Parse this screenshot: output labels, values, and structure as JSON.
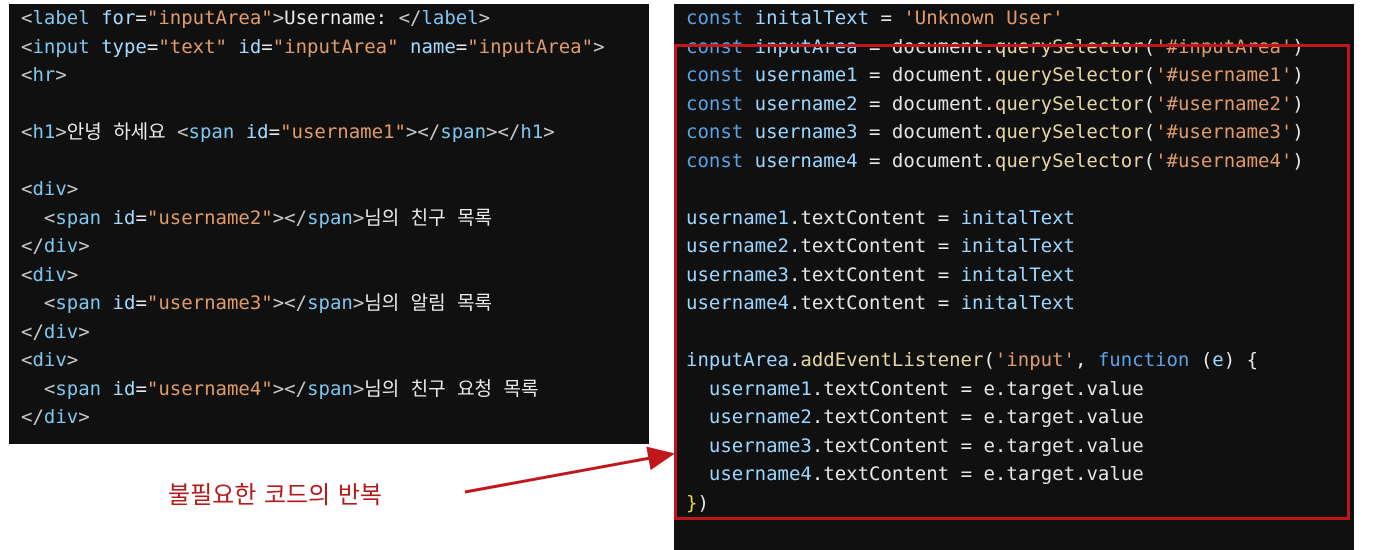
{
  "html_panel": {
    "lines": [
      [
        [
          "c-tag",
          "<"
        ],
        [
          "c-tagname",
          "label"
        ],
        [
          "c-attr",
          " for"
        ],
        [
          "c-punc",
          "="
        ],
        [
          "c-str",
          "\"inputArea\""
        ],
        [
          "c-tag",
          ">"
        ],
        [
          "c-text",
          "Username: "
        ],
        [
          "c-tag",
          "</"
        ],
        [
          "c-tagname",
          "label"
        ],
        [
          "c-tag",
          ">"
        ]
      ],
      [
        [
          "c-tag",
          "<"
        ],
        [
          "c-tagname",
          "input"
        ],
        [
          "c-attr",
          " type"
        ],
        [
          "c-punc",
          "="
        ],
        [
          "c-str",
          "\"text\""
        ],
        [
          "c-attr",
          " id"
        ],
        [
          "c-punc",
          "="
        ],
        [
          "c-str",
          "\"inputArea\""
        ],
        [
          "c-attr",
          " name"
        ],
        [
          "c-punc",
          "="
        ],
        [
          "c-str",
          "\"inputArea\""
        ],
        [
          "c-tag",
          ">"
        ]
      ],
      [
        [
          "c-tag",
          "<"
        ],
        [
          "c-tagname",
          "hr"
        ],
        [
          "c-tag",
          ">"
        ]
      ],
      [],
      [
        [
          "c-tag",
          "<"
        ],
        [
          "c-tagname",
          "h1"
        ],
        [
          "c-tag",
          ">"
        ],
        [
          "c-text",
          "안녕 하세요 "
        ],
        [
          "c-tag",
          "<"
        ],
        [
          "c-tagname",
          "span"
        ],
        [
          "c-attr",
          " id"
        ],
        [
          "c-punc",
          "="
        ],
        [
          "c-str",
          "\"username1\""
        ],
        [
          "c-tag",
          "></"
        ],
        [
          "c-tagname",
          "span"
        ],
        [
          "c-tag",
          "></"
        ],
        [
          "c-tagname",
          "h1"
        ],
        [
          "c-tag",
          ">"
        ]
      ],
      [],
      [
        [
          "c-tag",
          "<"
        ],
        [
          "c-tagname",
          "div"
        ],
        [
          "c-tag",
          ">"
        ]
      ],
      [
        [
          "c-text",
          "  "
        ],
        [
          "c-tag",
          "<"
        ],
        [
          "c-tagname",
          "span"
        ],
        [
          "c-attr",
          " id"
        ],
        [
          "c-punc",
          "="
        ],
        [
          "c-str",
          "\"username2\""
        ],
        [
          "c-tag",
          "></"
        ],
        [
          "c-tagname",
          "span"
        ],
        [
          "c-tag",
          ">"
        ],
        [
          "c-text",
          "님의 친구 목록"
        ]
      ],
      [
        [
          "c-tag",
          "</"
        ],
        [
          "c-tagname",
          "div"
        ],
        [
          "c-tag",
          ">"
        ]
      ],
      [
        [
          "c-tag",
          "<"
        ],
        [
          "c-tagname",
          "div"
        ],
        [
          "c-tag",
          ">"
        ]
      ],
      [
        [
          "c-text",
          "  "
        ],
        [
          "c-tag",
          "<"
        ],
        [
          "c-tagname",
          "span"
        ],
        [
          "c-attr",
          " id"
        ],
        [
          "c-punc",
          "="
        ],
        [
          "c-str",
          "\"username3\""
        ],
        [
          "c-tag",
          "></"
        ],
        [
          "c-tagname",
          "span"
        ],
        [
          "c-tag",
          ">"
        ],
        [
          "c-text",
          "님의 알림 목록"
        ]
      ],
      [
        [
          "c-tag",
          "</"
        ],
        [
          "c-tagname",
          "div"
        ],
        [
          "c-tag",
          ">"
        ]
      ],
      [
        [
          "c-tag",
          "<"
        ],
        [
          "c-tagname",
          "div"
        ],
        [
          "c-tag",
          ">"
        ]
      ],
      [
        [
          "c-text",
          "  "
        ],
        [
          "c-tag",
          "<"
        ],
        [
          "c-tagname",
          "span"
        ],
        [
          "c-attr",
          " id"
        ],
        [
          "c-punc",
          "="
        ],
        [
          "c-str",
          "\"username4\""
        ],
        [
          "c-tag",
          "></"
        ],
        [
          "c-tagname",
          "span"
        ],
        [
          "c-tag",
          ">"
        ],
        [
          "c-text",
          "님의 친구 요청 목록"
        ]
      ],
      [
        [
          "c-tag",
          "</"
        ],
        [
          "c-tagname",
          "div"
        ],
        [
          "c-tag",
          ">"
        ]
      ]
    ]
  },
  "js_panel": {
    "lines": [
      [
        [
          "c-kw",
          "const "
        ],
        [
          "c-var",
          "initalText"
        ],
        [
          "c-punc",
          " = "
        ],
        [
          "c-str",
          "'Unknown User'"
        ]
      ],
      [
        [
          "c-kw",
          "const "
        ],
        [
          "c-var",
          "inputArea"
        ],
        [
          "c-punc",
          " = "
        ],
        [
          "c-prop",
          "document"
        ],
        [
          "c-punc",
          "."
        ],
        [
          "c-fn",
          "querySelector"
        ],
        [
          "c-punc",
          "("
        ],
        [
          "c-str",
          "'#inputArea'"
        ],
        [
          "c-punc",
          ")"
        ]
      ],
      [
        [
          "c-kw",
          "const "
        ],
        [
          "c-var",
          "username1"
        ],
        [
          "c-punc",
          " = "
        ],
        [
          "c-prop",
          "document"
        ],
        [
          "c-punc",
          "."
        ],
        [
          "c-fn",
          "querySelector"
        ],
        [
          "c-punc",
          "("
        ],
        [
          "c-str",
          "'#username1'"
        ],
        [
          "c-punc",
          ")"
        ]
      ],
      [
        [
          "c-kw",
          "const "
        ],
        [
          "c-var",
          "username2"
        ],
        [
          "c-punc",
          " = "
        ],
        [
          "c-prop",
          "document"
        ],
        [
          "c-punc",
          "."
        ],
        [
          "c-fn",
          "querySelector"
        ],
        [
          "c-punc",
          "("
        ],
        [
          "c-str",
          "'#username2'"
        ],
        [
          "c-punc",
          ")"
        ]
      ],
      [
        [
          "c-kw",
          "const "
        ],
        [
          "c-var",
          "username3"
        ],
        [
          "c-punc",
          " = "
        ],
        [
          "c-prop",
          "document"
        ],
        [
          "c-punc",
          "."
        ],
        [
          "c-fn",
          "querySelector"
        ],
        [
          "c-punc",
          "("
        ],
        [
          "c-str",
          "'#username3'"
        ],
        [
          "c-punc",
          ")"
        ]
      ],
      [
        [
          "c-kw",
          "const "
        ],
        [
          "c-var",
          "username4"
        ],
        [
          "c-punc",
          " = "
        ],
        [
          "c-prop",
          "document"
        ],
        [
          "c-punc",
          "."
        ],
        [
          "c-fn",
          "querySelector"
        ],
        [
          "c-punc",
          "("
        ],
        [
          "c-str",
          "'#username4'"
        ],
        [
          "c-punc",
          ")"
        ]
      ],
      [],
      [
        [
          "c-var",
          "username1"
        ],
        [
          "c-punc",
          "."
        ],
        [
          "c-prop",
          "textContent"
        ],
        [
          "c-punc",
          " = "
        ],
        [
          "c-var",
          "initalText"
        ]
      ],
      [
        [
          "c-var",
          "username2"
        ],
        [
          "c-punc",
          "."
        ],
        [
          "c-prop",
          "textContent"
        ],
        [
          "c-punc",
          " = "
        ],
        [
          "c-var",
          "initalText"
        ]
      ],
      [
        [
          "c-var",
          "username3"
        ],
        [
          "c-punc",
          "."
        ],
        [
          "c-prop",
          "textContent"
        ],
        [
          "c-punc",
          " = "
        ],
        [
          "c-var",
          "initalText"
        ]
      ],
      [
        [
          "c-var",
          "username4"
        ],
        [
          "c-punc",
          "."
        ],
        [
          "c-prop",
          "textContent"
        ],
        [
          "c-punc",
          " = "
        ],
        [
          "c-var",
          "initalText"
        ]
      ],
      [],
      [
        [
          "c-var",
          "inputArea"
        ],
        [
          "c-punc",
          "."
        ],
        [
          "c-fn",
          "addEventListener"
        ],
        [
          "c-punc",
          "("
        ],
        [
          "c-str",
          "'input'"
        ],
        [
          "c-punc",
          ", "
        ],
        [
          "c-kw",
          "function"
        ],
        [
          "c-punc",
          " ("
        ],
        [
          "c-param",
          "e"
        ],
        [
          "c-punc",
          ") {"
        ]
      ],
      [
        [
          "c-punc",
          "  "
        ],
        [
          "c-var",
          "username1"
        ],
        [
          "c-punc",
          "."
        ],
        [
          "c-prop",
          "textContent"
        ],
        [
          "c-punc",
          " = "
        ],
        [
          "c-prop",
          "e"
        ],
        [
          "c-punc",
          "."
        ],
        [
          "c-prop",
          "target"
        ],
        [
          "c-punc",
          "."
        ],
        [
          "c-prop",
          "value"
        ]
      ],
      [
        [
          "c-punc",
          "  "
        ],
        [
          "c-var",
          "username2"
        ],
        [
          "c-punc",
          "."
        ],
        [
          "c-prop",
          "textContent"
        ],
        [
          "c-punc",
          " = "
        ],
        [
          "c-prop",
          "e"
        ],
        [
          "c-punc",
          "."
        ],
        [
          "c-prop",
          "target"
        ],
        [
          "c-punc",
          "."
        ],
        [
          "c-prop",
          "value"
        ]
      ],
      [
        [
          "c-punc",
          "  "
        ],
        [
          "c-var",
          "username3"
        ],
        [
          "c-punc",
          "."
        ],
        [
          "c-prop",
          "textContent"
        ],
        [
          "c-punc",
          " = "
        ],
        [
          "c-prop",
          "e"
        ],
        [
          "c-punc",
          "."
        ],
        [
          "c-prop",
          "target"
        ],
        [
          "c-punc",
          "."
        ],
        [
          "c-prop",
          "value"
        ]
      ],
      [
        [
          "c-punc",
          "  "
        ],
        [
          "c-var",
          "username4"
        ],
        [
          "c-punc",
          "."
        ],
        [
          "c-prop",
          "textContent"
        ],
        [
          "c-punc",
          " = "
        ],
        [
          "c-prop",
          "e"
        ],
        [
          "c-punc",
          "."
        ],
        [
          "c-prop",
          "target"
        ],
        [
          "c-punc",
          "."
        ],
        [
          "c-prop",
          "value"
        ]
      ],
      [
        [
          "c-yellow",
          "}"
        ],
        [
          "c-punc",
          ")"
        ]
      ]
    ]
  },
  "annotation": {
    "label": "불필요한 코드의 반복",
    "color": "#c0171d"
  }
}
